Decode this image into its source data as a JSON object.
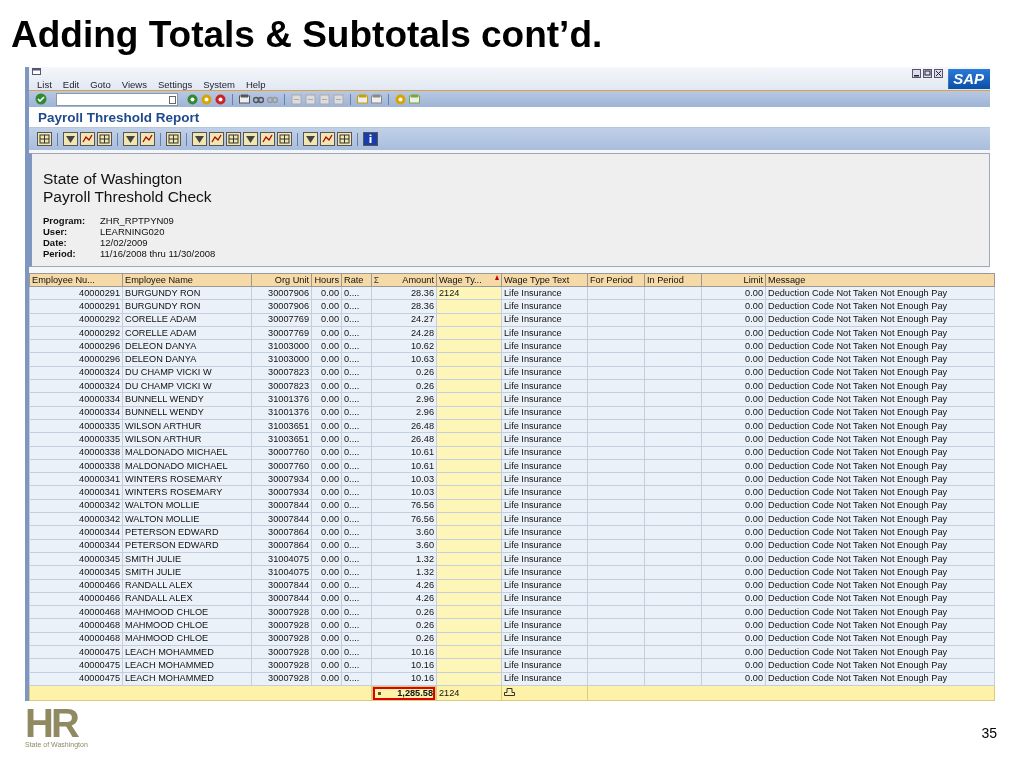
{
  "slide": {
    "title": "Adding Totals & Subtotals cont’d.",
    "page_number": "35",
    "logo": {
      "letters": "HR",
      "caption": "State of Washington"
    }
  },
  "sap": {
    "menu": [
      "List",
      "Edit",
      "Goto",
      "Views",
      "Settings",
      "System",
      "Help"
    ],
    "brand": "SAP",
    "screen_title": "Payroll Threshold Report",
    "heading": [
      "State of Washington",
      "Payroll Threshold Check"
    ],
    "fields": [
      {
        "label": "Program:",
        "value": "ZHR_RPTPYN09"
      },
      {
        "label": "User:",
        "value": "LEARNING020"
      },
      {
        "label": "Date:",
        "value": "12/02/2009"
      },
      {
        "label": "Period:",
        "value": "11/16/2008 thru 11/30/2008"
      }
    ],
    "columns": [
      "Employee Nu...",
      "Employee Name",
      "Org Unit",
      "Hours",
      "Rate",
      "Amount",
      "Wage Ty...",
      "Wage Type Text",
      "For Period",
      "In   Period",
      "Limit",
      "Message"
    ],
    "rows": [
      {
        "number": "40000291",
        "name": "BURGUNDY RON",
        "org_unit": "30007906",
        "hours": "0.00",
        "rate": "0....",
        "amount": "28.36",
        "wage_type": "2124",
        "wage_type_text": "Life Insurance",
        "limit": "0.00",
        "message": "Deduction Code Not Taken Not Enough Pay"
      },
      {
        "number": "40000291",
        "name": "BURGUNDY RON",
        "org_unit": "30007906",
        "hours": "0.00",
        "rate": "0....",
        "amount": "28.36",
        "wage_type_text": "Life Insurance",
        "limit": "0.00",
        "message": "Deduction Code Not Taken Not Enough Pay"
      },
      {
        "number": "40000292",
        "name": "CORELLE ADAM",
        "org_unit": "30007769",
        "hours": "0.00",
        "rate": "0....",
        "amount": "24.27",
        "wage_type_text": "Life Insurance",
        "limit": "0.00",
        "message": "Deduction Code Not Taken Not Enough Pay"
      },
      {
        "number": "40000292",
        "name": "CORELLE ADAM",
        "org_unit": "30007769",
        "hours": "0.00",
        "rate": "0....",
        "amount": "24.28",
        "wage_type_text": "Life Insurance",
        "limit": "0.00",
        "message": "Deduction Code Not Taken Not Enough Pay"
      },
      {
        "number": "40000296",
        "name": "DELEON DANYA",
        "org_unit": "31003000",
        "hours": "0.00",
        "rate": "0....",
        "amount": "10.62",
        "wage_type_text": "Life Insurance",
        "limit": "0.00",
        "message": "Deduction Code Not Taken Not Enough Pay"
      },
      {
        "number": "40000296",
        "name": "DELEON DANYA",
        "org_unit": "31003000",
        "hours": "0.00",
        "rate": "0....",
        "amount": "10.63",
        "wage_type_text": "Life Insurance",
        "limit": "0.00",
        "message": "Deduction Code Not Taken Not Enough Pay"
      },
      {
        "number": "40000324",
        "name": "DU CHAMP VICKI W",
        "org_unit": "30007823",
        "hours": "0.00",
        "rate": "0....",
        "amount": "0.26",
        "wage_type_text": "Life Insurance",
        "limit": "0.00",
        "message": "Deduction Code Not Taken Not Enough Pay"
      },
      {
        "number": "40000324",
        "name": "DU CHAMP VICKI W",
        "org_unit": "30007823",
        "hours": "0.00",
        "rate": "0....",
        "amount": "0.26",
        "wage_type_text": "Life Insurance",
        "limit": "0.00",
        "message": "Deduction Code Not Taken Not Enough Pay"
      },
      {
        "number": "40000334",
        "name": "BUNNELL WENDY",
        "org_unit": "31001376",
        "hours": "0.00",
        "rate": "0....",
        "amount": "2.96",
        "wage_type_text": "Life Insurance",
        "limit": "0.00",
        "message": "Deduction Code Not Taken Not Enough Pay"
      },
      {
        "number": "40000334",
        "name": "BUNNELL WENDY",
        "org_unit": "31001376",
        "hours": "0.00",
        "rate": "0....",
        "amount": "2.96",
        "wage_type_text": "Life Insurance",
        "limit": "0.00",
        "message": "Deduction Code Not Taken Not Enough Pay"
      },
      {
        "number": "40000335",
        "name": "WILSON ARTHUR",
        "org_unit": "31003651",
        "hours": "0.00",
        "rate": "0....",
        "amount": "26.48",
        "wage_type_text": "Life Insurance",
        "limit": "0.00",
        "message": "Deduction Code Not Taken Not Enough Pay"
      },
      {
        "number": "40000335",
        "name": "WILSON ARTHUR",
        "org_unit": "31003651",
        "hours": "0.00",
        "rate": "0....",
        "amount": "26.48",
        "wage_type_text": "Life Insurance",
        "limit": "0.00",
        "message": "Deduction Code Not Taken Not Enough Pay"
      },
      {
        "number": "40000338",
        "name": "MALDONADO MICHAEL",
        "org_unit": "30007760",
        "hours": "0.00",
        "rate": "0....",
        "amount": "10.61",
        "wage_type_text": "Life Insurance",
        "limit": "0.00",
        "message": "Deduction Code Not Taken Not Enough Pay"
      },
      {
        "number": "40000338",
        "name": "MALDONADO MICHAEL",
        "org_unit": "30007760",
        "hours": "0.00",
        "rate": "0....",
        "amount": "10.61",
        "wage_type_text": "Life Insurance",
        "limit": "0.00",
        "message": "Deduction Code Not Taken Not Enough Pay"
      },
      {
        "number": "40000341",
        "name": "WINTERS ROSEMARY",
        "org_unit": "30007934",
        "hours": "0.00",
        "rate": "0....",
        "amount": "10.03",
        "wage_type_text": "Life Insurance",
        "limit": "0.00",
        "message": "Deduction Code Not Taken Not Enough Pay"
      },
      {
        "number": "40000341",
        "name": "WINTERS ROSEMARY",
        "org_unit": "30007934",
        "hours": "0.00",
        "rate": "0....",
        "amount": "10.03",
        "wage_type_text": "Life Insurance",
        "limit": "0.00",
        "message": "Deduction Code Not Taken Not Enough Pay"
      },
      {
        "number": "40000342",
        "name": "WALTON MOLLIE",
        "org_unit": "30007844",
        "hours": "0.00",
        "rate": "0....",
        "amount": "76.56",
        "wage_type_text": "Life Insurance",
        "limit": "0.00",
        "message": "Deduction Code Not Taken Not Enough Pay"
      },
      {
        "number": "40000342",
        "name": "WALTON MOLLIE",
        "org_unit": "30007844",
        "hours": "0.00",
        "rate": "0....",
        "amount": "76.56",
        "wage_type_text": "Life Insurance",
        "limit": "0.00",
        "message": "Deduction Code Not Taken Not Enough Pay"
      },
      {
        "number": "40000344",
        "name": "PETERSON EDWARD",
        "org_unit": "30007864",
        "hours": "0.00",
        "rate": "0....",
        "amount": "3.60",
        "wage_type_text": "Life Insurance",
        "limit": "0.00",
        "message": "Deduction Code Not Taken Not Enough Pay"
      },
      {
        "number": "40000344",
        "name": "PETERSON EDWARD",
        "org_unit": "30007864",
        "hours": "0.00",
        "rate": "0....",
        "amount": "3.60",
        "wage_type_text": "Life Insurance",
        "limit": "0.00",
        "message": "Deduction Code Not Taken Not Enough Pay"
      },
      {
        "number": "40000345",
        "name": "SMITH JULIE",
        "org_unit": "31004075",
        "hours": "0.00",
        "rate": "0....",
        "amount": "1.32",
        "wage_type_text": "Life Insurance",
        "limit": "0.00",
        "message": "Deduction Code Not Taken Not Enough Pay"
      },
      {
        "number": "40000345",
        "name": "SMITH JULIE",
        "org_unit": "31004075",
        "hours": "0.00",
        "rate": "0....",
        "amount": "1.32",
        "wage_type_text": "Life Insurance",
        "limit": "0.00",
        "message": "Deduction Code Not Taken Not Enough Pay"
      },
      {
        "number": "40000466",
        "name": "RANDALL ALEX",
        "org_unit": "30007844",
        "hours": "0.00",
        "rate": "0....",
        "amount": "4.26",
        "wage_type_text": "Life Insurance",
        "limit": "0.00",
        "message": "Deduction Code Not Taken Not Enough Pay"
      },
      {
        "number": "40000466",
        "name": "RANDALL ALEX",
        "org_unit": "30007844",
        "hours": "0.00",
        "rate": "0....",
        "amount": "4.26",
        "wage_type_text": "Life Insurance",
        "limit": "0.00",
        "message": "Deduction Code Not Taken Not Enough Pay"
      },
      {
        "number": "40000468",
        "name": "MAHMOOD CHLOE",
        "org_unit": "30007928",
        "hours": "0.00",
        "rate": "0....",
        "amount": "0.26",
        "wage_type_text": "Life Insurance",
        "limit": "0.00",
        "message": "Deduction Code Not Taken Not Enough Pay"
      },
      {
        "number": "40000468",
        "name": "MAHMOOD CHLOE",
        "org_unit": "30007928",
        "hours": "0.00",
        "rate": "0....",
        "amount": "0.26",
        "wage_type_text": "Life Insurance",
        "limit": "0.00",
        "message": "Deduction Code Not Taken Not Enough Pay"
      },
      {
        "number": "40000468",
        "name": "MAHMOOD CHLOE",
        "org_unit": "30007928",
        "hours": "0.00",
        "rate": "0....",
        "amount": "0.26",
        "wage_type_text": "Life Insurance",
        "limit": "0.00",
        "message": "Deduction Code Not Taken Not Enough Pay"
      },
      {
        "number": "40000475",
        "name": "LEACH MOHAMMED",
        "org_unit": "30007928",
        "hours": "0.00",
        "rate": "0....",
        "amount": "10.16",
        "wage_type_text": "Life Insurance",
        "limit": "0.00",
        "message": "Deduction Code Not Taken Not Enough Pay"
      },
      {
        "number": "40000475",
        "name": "LEACH MOHAMMED",
        "org_unit": "30007928",
        "hours": "0.00",
        "rate": "0....",
        "amount": "10.16",
        "wage_type_text": "Life Insurance",
        "limit": "0.00",
        "message": "Deduction Code Not Taken Not Enough Pay"
      },
      {
        "number": "40000475",
        "name": "LEACH MOHAMMED",
        "org_unit": "30007928",
        "hours": "0.00",
        "rate": "0....",
        "amount": "10.16",
        "wage_type_text": "Life Insurance",
        "limit": "0.00",
        "message": "Deduction Code Not Taken Not Enough Pay"
      }
    ],
    "total": {
      "amount": "1,285.58",
      "wage_type": "2124",
      "highlighted": true
    }
  }
}
